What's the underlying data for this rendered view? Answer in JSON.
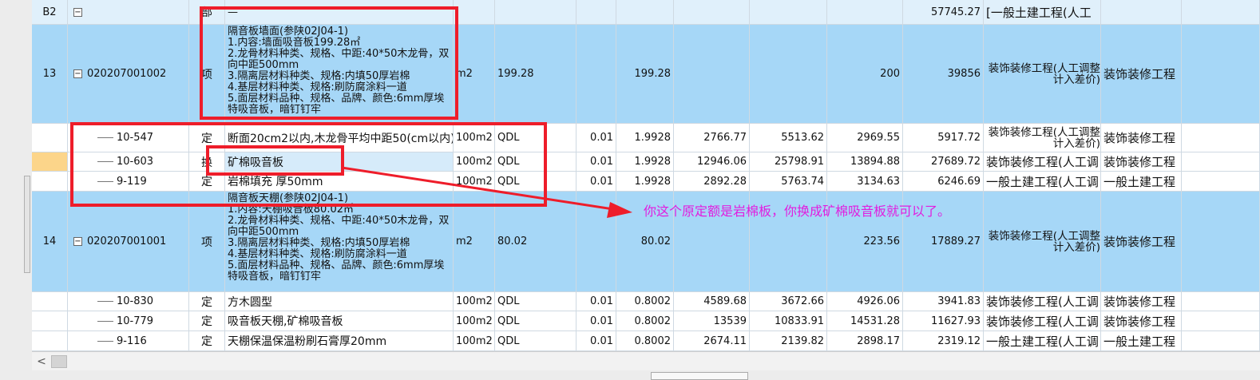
{
  "rows": {
    "r_b2": {
      "num": "B2",
      "code": "",
      "type": "部",
      "name": "—",
      "unit": "",
      "expr": "",
      "coef": "",
      "qty": "",
      "p1": "",
      "p2": "",
      "p3": "",
      "total": "57745.27",
      "prof": "[一般土建工程(人工",
      "prof2": ""
    },
    "r13": {
      "num": "13",
      "code": "020207001002",
      "type": "项",
      "name": "隔音板墙面(参陕02J04-1)\n1.内容:墙面吸音板199.28㎡\n2.龙骨材料种类、规格、中距:40*50木龙骨，双向中距500mm\n3.隔离层材料种类、规格:内填50厚岩棉\n4.基层材料种类、规格:刷防腐涂料一道\n5.面层材料品种、规格、品牌、颜色:6mm厚埃特吸音板，暗钉钉牢",
      "unit": "m2",
      "expr": "199.28",
      "coef": "",
      "qty": "199.28",
      "p1": "",
      "p2": "",
      "p3": "200",
      "total": "39856",
      "prof": "装饰装修工程(人工调整计入差价)",
      "prof2": "装饰装修工程"
    },
    "r10_547": {
      "num": "",
      "code": "10-547",
      "type": "定",
      "name": "断面20cm2以内,木龙骨平均中距50(cm以内)",
      "unit": "100m2",
      "expr": "QDL",
      "coef": "0.01",
      "qty": "1.9928",
      "p1": "2766.77",
      "p2": "5513.62",
      "p3": "2969.55",
      "total": "5917.72",
      "prof": "装饰装修工程(人工调整计入差价)",
      "prof2": "装饰装修工程"
    },
    "r10_603": {
      "num": "",
      "code": "10-603",
      "type": "换",
      "name": "矿棉吸音板",
      "unit": "100m2",
      "expr": "QDL",
      "coef": "0.01",
      "qty": "1.9928",
      "p1": "12946.06",
      "p2": "25798.91",
      "p3": "13894.88",
      "total": "27689.72",
      "prof": "装饰装修工程(人工调",
      "prof2": "装饰装修工程"
    },
    "r9_119": {
      "num": "",
      "code": "9-119",
      "type": "定",
      "name": "岩棉填充 厚50mm",
      "unit": "100m2",
      "expr": "QDL",
      "coef": "0.01",
      "qty": "1.9928",
      "p1": "2892.28",
      "p2": "5763.74",
      "p3": "3134.63",
      "total": "6246.69",
      "prof": "一般土建工程(人工调",
      "prof2": "一般土建工程"
    },
    "r14": {
      "num": "14",
      "code": "020207001001",
      "type": "项",
      "name": "隔音板天棚(参陕02J04-1)\n1.内容:天棚吸音板80.02㎡\n2.龙骨材料种类、规格、中距:40*50木龙骨，双向中距500mm\n3.隔离层材料种类、规格:内填50厚岩棉\n4.基层材料种类、规格:刷防腐涂料一道\n5.面层材料品种、规格、品牌、颜色:6mm厚埃特吸音板，暗钉钉牢",
      "unit": "m2",
      "expr": "80.02",
      "coef": "",
      "qty": "80.02",
      "p1": "",
      "p2": "",
      "p3": "223.56",
      "total": "17889.27",
      "prof": "装饰装修工程(人工调整计入差价)",
      "prof2": "装饰装修工程"
    },
    "r10_830": {
      "num": "",
      "code": "10-830",
      "type": "定",
      "name": "方木圆型",
      "unit": "100m2",
      "expr": "QDL",
      "coef": "0.01",
      "qty": "0.8002",
      "p1": "4589.68",
      "p2": "3672.66",
      "p3": "4926.06",
      "total": "3941.83",
      "prof": "装饰装修工程(人工调",
      "prof2": "装饰装修工程"
    },
    "r10_779": {
      "num": "",
      "code": "10-779",
      "type": "定",
      "name": "吸音板天棚,矿棉吸音板",
      "unit": "100m2",
      "expr": "QDL",
      "coef": "0.01",
      "qty": "0.8002",
      "p1": "13539",
      "p2": "10833.91",
      "p3": "14531.28",
      "total": "11627.93",
      "prof": "装饰装修工程(人工调",
      "prof2": "装饰装修工程"
    },
    "r9_116": {
      "num": "",
      "code": "9-116",
      "type": "定",
      "name": "天棚保温保温粉刷石膏厚20mm",
      "unit": "100m2",
      "expr": "QDL",
      "coef": "0.01",
      "qty": "0.8002",
      "p1": "2674.11",
      "p2": "2139.82",
      "p3": "2898.17",
      "total": "2319.12",
      "prof": "一般土建工程(人工调",
      "prof2": "一般土建工程"
    }
  },
  "annotation": {
    "note": "你这个原定额是岩棉板，你换成矿棉吸音板就可以了。",
    "note_color": "#e21ddf",
    "box_color": "#ee1d2a"
  },
  "colors": {
    "selected_row": "#a6d7f7",
    "current_row_marker": "#fcd58a"
  }
}
